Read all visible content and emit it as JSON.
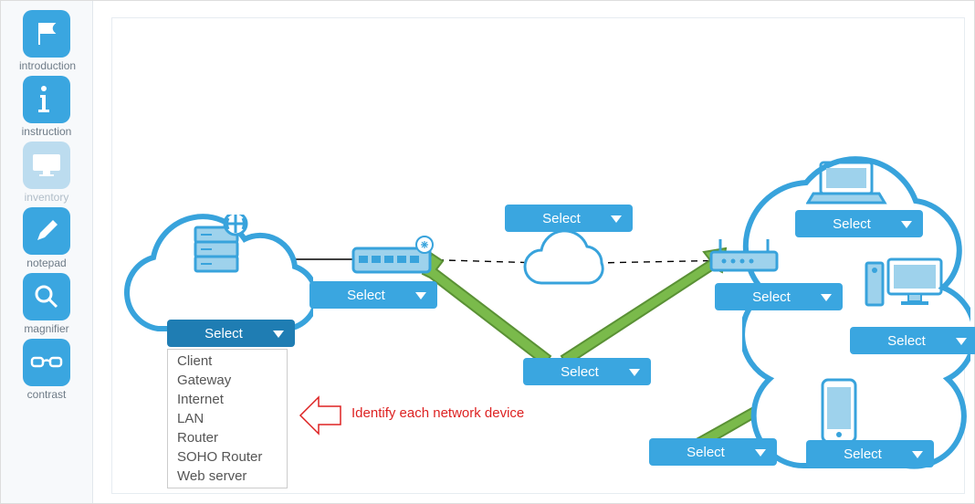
{
  "sidebar": {
    "items": [
      {
        "label": "introduction",
        "icon": "flag",
        "active": true
      },
      {
        "label": "instruction",
        "icon": "info",
        "active": true
      },
      {
        "label": "inventory",
        "icon": "monitor",
        "active": false
      },
      {
        "label": "notepad",
        "icon": "pencil",
        "active": true
      },
      {
        "label": "magnifier",
        "icon": "magnifier",
        "active": true
      },
      {
        "label": "contrast",
        "icon": "glasses",
        "active": true
      }
    ]
  },
  "diagram": {
    "dropdowns": {
      "webserver": {
        "label": "Select",
        "open": true
      },
      "switch": {
        "label": "Select"
      },
      "cloud_top": {
        "label": "Select"
      },
      "cloud_bottom": {
        "label": "Select"
      },
      "soho": {
        "label": "Select"
      },
      "laptop": {
        "label": "Select"
      },
      "pc": {
        "label": "Select"
      },
      "phone": {
        "label": "Select"
      },
      "lan": {
        "label": "Select"
      }
    },
    "options": [
      "Client",
      "Gateway",
      "Internet",
      "LAN",
      "Router",
      "SOHO Router",
      "Web server"
    ],
    "annotation": "Identify each network device"
  }
}
